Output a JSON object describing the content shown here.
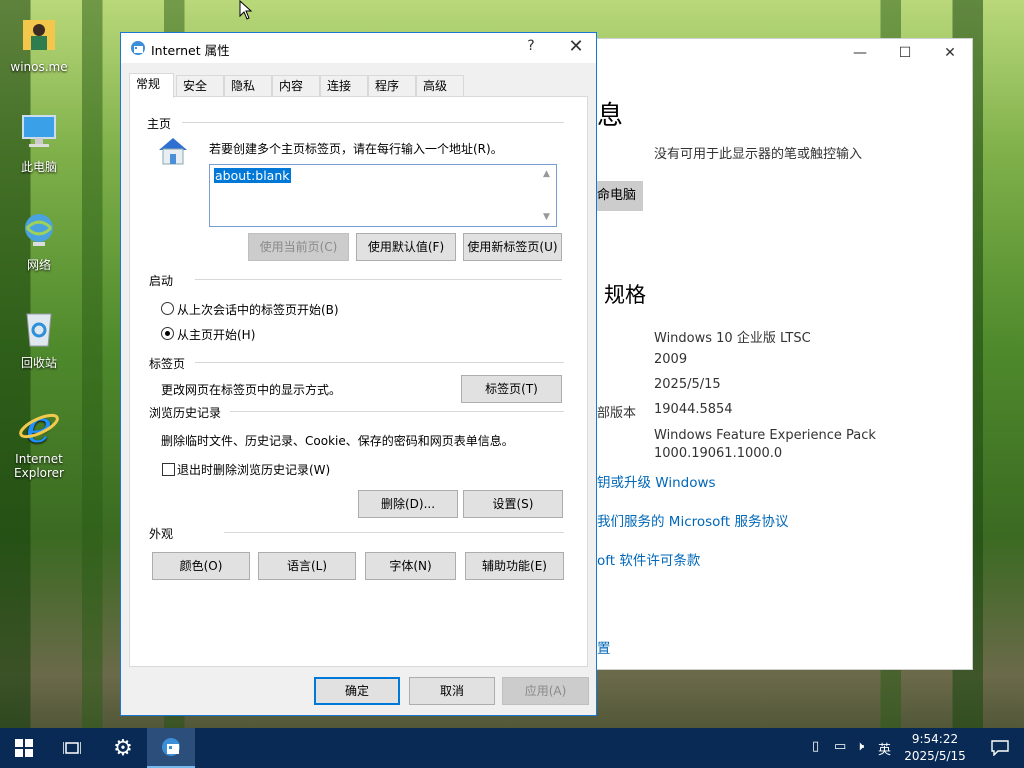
{
  "desktop": {
    "icons": [
      {
        "label": "winos.me",
        "icon": "user-folder-icon"
      },
      {
        "label": "此电脑",
        "icon": "computer-icon"
      },
      {
        "label": "网络",
        "icon": "network-icon"
      },
      {
        "label": "回收站",
        "icon": "recycle-bin-icon"
      },
      {
        "label": "Internet Explorer",
        "icon": "internet-explorer-icon"
      }
    ]
  },
  "background_window": {
    "heading_partial": "息",
    "pen_touch": "没有可用于此显示器的笔或触控输入",
    "rename_button_partial": "命电脑",
    "spec_heading": "规格",
    "specs": {
      "edition": "Windows 10 企业版 LTSC",
      "version": "2009",
      "installed_on": "2025/5/15",
      "os_build_label_partial": "部版本",
      "os_build": "19044.5854",
      "experience_line1": "Windows Feature Experience Pack",
      "experience_line2": "1000.19061.1000.0"
    },
    "links": {
      "upgrade": "钥或升级 Windows",
      "service_agreement": "我们服务的 Microsoft 服务协议",
      "license": "oft 软件许可条款",
      "settings_partial": "置"
    }
  },
  "dialog": {
    "title": "Internet 属性",
    "help": "?",
    "close": "✕",
    "tabs": [
      "常规",
      "安全",
      "隐私",
      "内容",
      "连接",
      "程序",
      "高级"
    ],
    "homepage": {
      "title": "主页",
      "instruction": "若要创建多个主页标签页，请在每行输入一个地址(R)。",
      "url_value": "about:blank",
      "use_current": "使用当前页(C)",
      "use_default": "使用默认值(F)",
      "use_new_tab": "使用新标签页(U)"
    },
    "startup": {
      "title": "启动",
      "option_last_session": "从上次会话中的标签页开始(B)",
      "option_home_page": "从主页开始(H)",
      "selected": "从主页开始(H)"
    },
    "tabs_group": {
      "title": "标签页",
      "description": "更改网页在标签页中的显示方式。",
      "button": "标签页(T)"
    },
    "history": {
      "title": "浏览历史记录",
      "description": "删除临时文件、历史记录、Cookie、保存的密码和网页表单信息。",
      "delete_on_exit": "退出时删除浏览历史记录(W)",
      "delete_on_exit_checked": false,
      "delete_button": "删除(D)...",
      "settings_button": "设置(S)"
    },
    "appearance": {
      "title": "外观",
      "colors": "颜色(O)",
      "languages": "语言(L)",
      "fonts": "字体(N)",
      "accessibility": "辅助功能(E)"
    },
    "footer": {
      "ok": "确定",
      "cancel": "取消",
      "apply": "应用(A)"
    }
  },
  "taskbar": {
    "ime": "英",
    "time": "9:54:22",
    "date": "2025/5/15"
  },
  "colors": {
    "accent": "#0078d7",
    "link": "#0067b8",
    "taskbar": "#082a55"
  }
}
